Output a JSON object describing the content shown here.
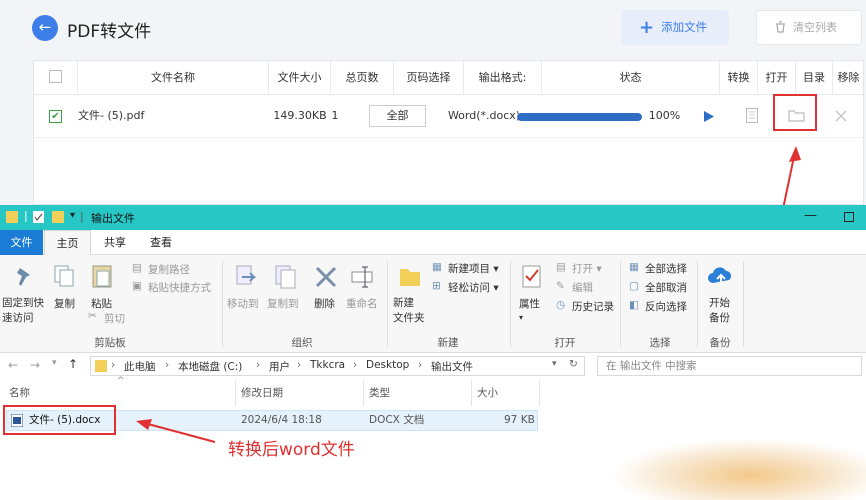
{
  "app": {
    "title": "PDF转文件",
    "add_label": "添加文件",
    "clear_label": "清空列表",
    "columns": [
      "文件名称",
      "文件大小",
      "总页数",
      "页码选择",
      "输出格式:",
      "状态",
      "转换",
      "打开",
      "目录",
      "移除"
    ],
    "row": {
      "name": "文件- (5).pdf",
      "size": "149.30KB",
      "pages": "1",
      "page_select": "全部",
      "format": "Word(*.docx)",
      "progress_percent": 100,
      "progress_label": "100%"
    }
  },
  "explorer": {
    "window_title": "输出文件",
    "tabs": {
      "file": "文件",
      "home": "主页",
      "share": "共享",
      "view": "查看"
    },
    "ribbon": {
      "pin": "固定到快\n速访问",
      "copy": "复制",
      "paste": "粘贴",
      "copy_path": "复制路径",
      "paste_shortcut": "粘贴快捷方式",
      "cut": "剪切",
      "clipboard": "剪贴板",
      "move_to": "移动到",
      "copy_to": "复制到",
      "delete": "删除",
      "rename": "重命名",
      "organize": "组织",
      "new_item": "新建项目",
      "easy_access": "轻松访问",
      "new_folder": "新建\n文件夹",
      "new": "新建",
      "properties": "属性",
      "open": "打开",
      "edit": "编辑",
      "history": "历史记录",
      "open_group": "打开",
      "select_all": "全部选择",
      "select_none": "全部取消",
      "invert": "反向选择",
      "select": "选择",
      "backup_start": "开始\n备份",
      "backup": "备份"
    },
    "breadcrumb": [
      "此电脑",
      "本地磁盘 (C:)",
      "用户",
      "Tkkcra",
      "Desktop",
      "输出文件"
    ],
    "search_placeholder": "在 输出文件 中搜索",
    "headers": {
      "name": "名称",
      "date": "修改日期",
      "type": "类型",
      "size": "大小"
    },
    "file": {
      "name": "文件- (5).docx",
      "date": "2024/6/4 18:18",
      "type": "DOCX 文档",
      "size": "97 KB"
    },
    "annotation": "转换后word文件"
  }
}
